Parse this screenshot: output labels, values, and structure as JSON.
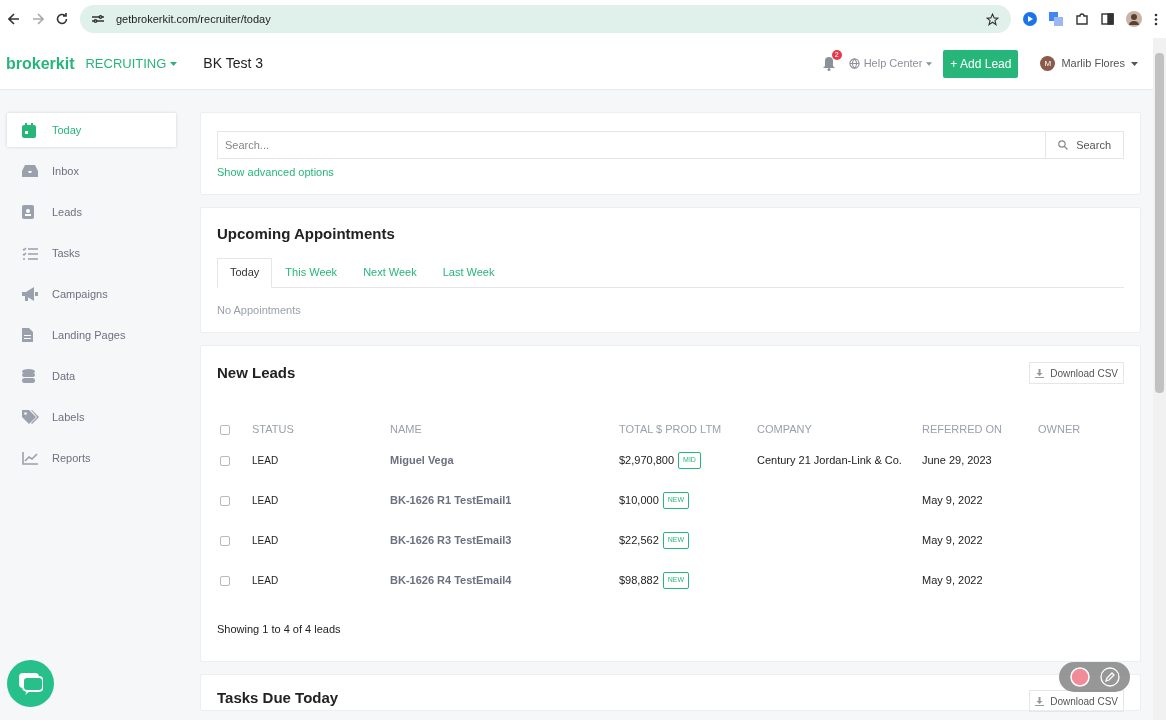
{
  "browser": {
    "url": "getbrokerkit.com/recruiter/today"
  },
  "header": {
    "logo": "brokerkit",
    "module": "RECRUITING",
    "account": "BK Test 3",
    "notifications": "2",
    "help": "Help Center",
    "add_button": "+ Add Lead",
    "user_initial": "M",
    "user": "Marlib Flores"
  },
  "sidebar": {
    "items": [
      {
        "label": "Today",
        "selected": true
      },
      {
        "label": "Inbox",
        "selected": false
      },
      {
        "label": "Leads",
        "selected": false
      },
      {
        "label": "Tasks",
        "selected": false
      },
      {
        "label": "Campaigns",
        "selected": false
      },
      {
        "label": "Landing Pages",
        "selected": false
      },
      {
        "label": "Data",
        "selected": false
      },
      {
        "label": "Labels",
        "selected": false
      },
      {
        "label": "Reports",
        "selected": false
      }
    ]
  },
  "search": {
    "placeholder": "Search...",
    "button": "Search",
    "advanced": "Show advanced options"
  },
  "appointments": {
    "title": "Upcoming Appointments",
    "tabs": [
      {
        "label": "Today",
        "selected": true
      },
      {
        "label": "This Week",
        "selected": false
      },
      {
        "label": "Next Week",
        "selected": false
      },
      {
        "label": "Last Week",
        "selected": false
      }
    ],
    "empty": "No Appointments"
  },
  "new_leads": {
    "title": "New Leads",
    "download": "Download CSV",
    "select_all_checked": false,
    "columns": [
      "STATUS",
      "NAME",
      "TOTAL $ PROD LTM",
      "COMPANY",
      "REFERRED ON",
      "OWNER"
    ],
    "rows": [
      {
        "checked": false,
        "status": "LEAD",
        "name": "Miguel Vega",
        "total": "$2,970,800",
        "tag": "MID",
        "company": "Century 21 Jordan-Link & Co.",
        "referred": "June 29, 2023"
      },
      {
        "checked": false,
        "status": "LEAD",
        "name": "BK-1626 R1 TestEmail1",
        "total": "$10,000",
        "tag": "NEW",
        "referred": "May 9, 2022"
      },
      {
        "checked": false,
        "status": "LEAD",
        "name": "BK-1626 R3 TestEmail3",
        "total": "$22,562",
        "tag": "NEW",
        "referred": "May 9, 2022"
      },
      {
        "checked": false,
        "status": "LEAD",
        "name": "BK-1626 R4 TestEmail4",
        "total": "$98,882",
        "tag": "NEW",
        "referred": "May 9, 2022"
      }
    ],
    "footer": "Showing 1 to 4 of 4 leads"
  },
  "tasks_due": {
    "title": "Tasks Due Today",
    "download": "Download CSV"
  }
}
